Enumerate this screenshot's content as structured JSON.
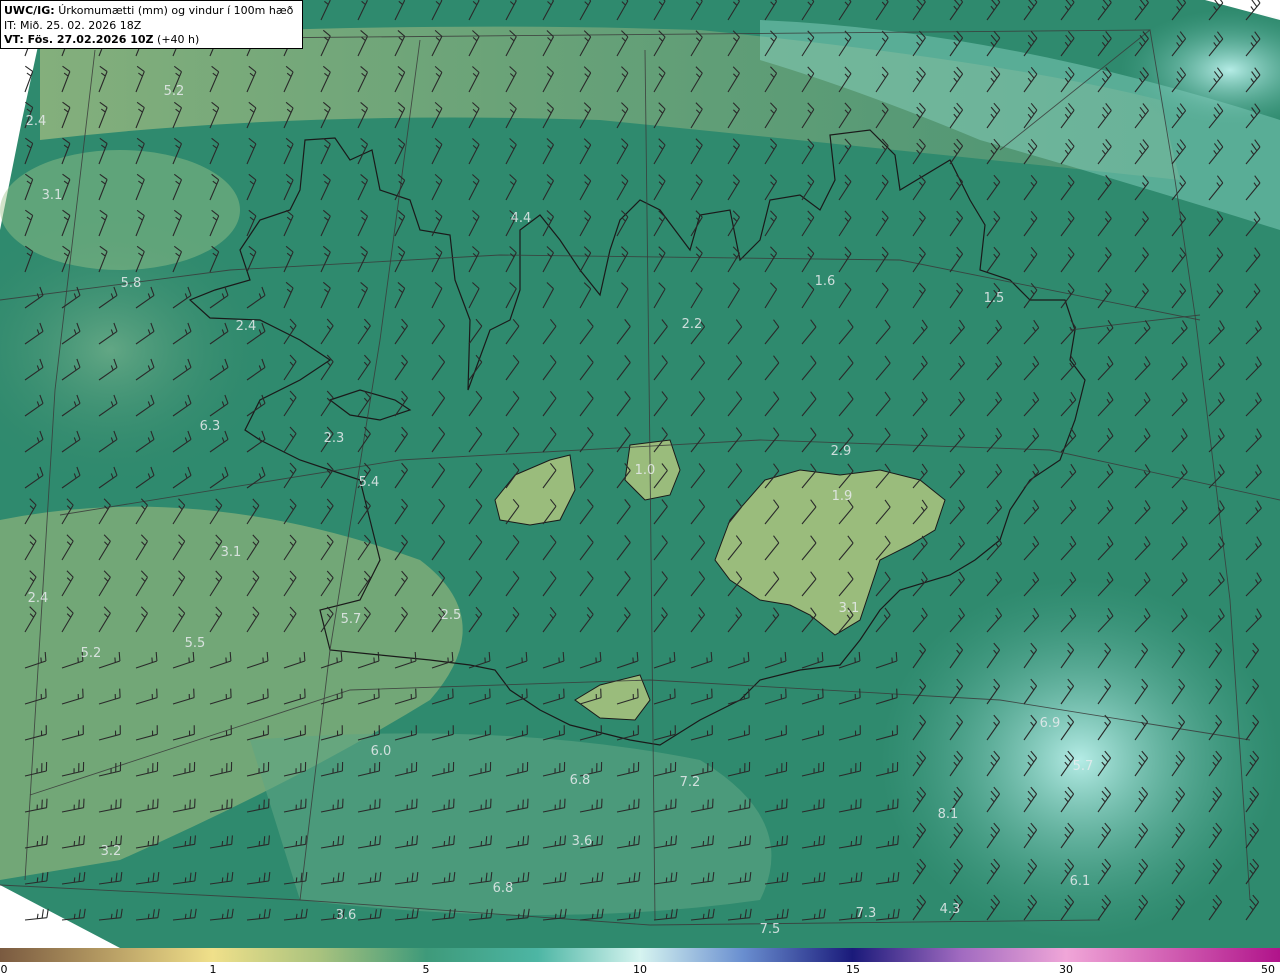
{
  "header": {
    "model": "UWC/IG:",
    "title_rest": "Úrkomumætti (mm) og vindur í 100m hæð",
    "issue_time": "IT: Mið. 25. 02. 2026 18Z",
    "valid_label": "VT: Fös. 27.02.2026 10Z",
    "valid_offset": "(+40 h)"
  },
  "colorbar": {
    "ticks": [
      "0",
      "1",
      "5",
      "10",
      "15",
      "30",
      "50"
    ]
  },
  "map_labels": {
    "values": [
      "5.2",
      "2.4",
      "3.1",
      "5.8",
      "2.4",
      "6.3",
      "2.3",
      "5.4",
      "3.1",
      "2.4",
      "5.2",
      "5.5",
      "5.7",
      "2.5",
      "4.4",
      "2.2",
      "1.6",
      "1.5",
      "1.0",
      "2.9",
      "1.9",
      "3.1",
      "6.0",
      "6.8",
      "7.2",
      "3.6",
      "6.8",
      "3.6",
      "3.2",
      "7.5",
      "7.3",
      "4.3",
      "8.1",
      "5.7",
      "6.9",
      "6.1"
    ]
  },
  "colors": {
    "sea_deep": "#1f6f5c",
    "sea_mid": "#3d9a80",
    "land_low": "#8db07a",
    "land_high": "#e8df8c",
    "cyan": "#a6e6e0",
    "barb": "#2a2a2a"
  }
}
